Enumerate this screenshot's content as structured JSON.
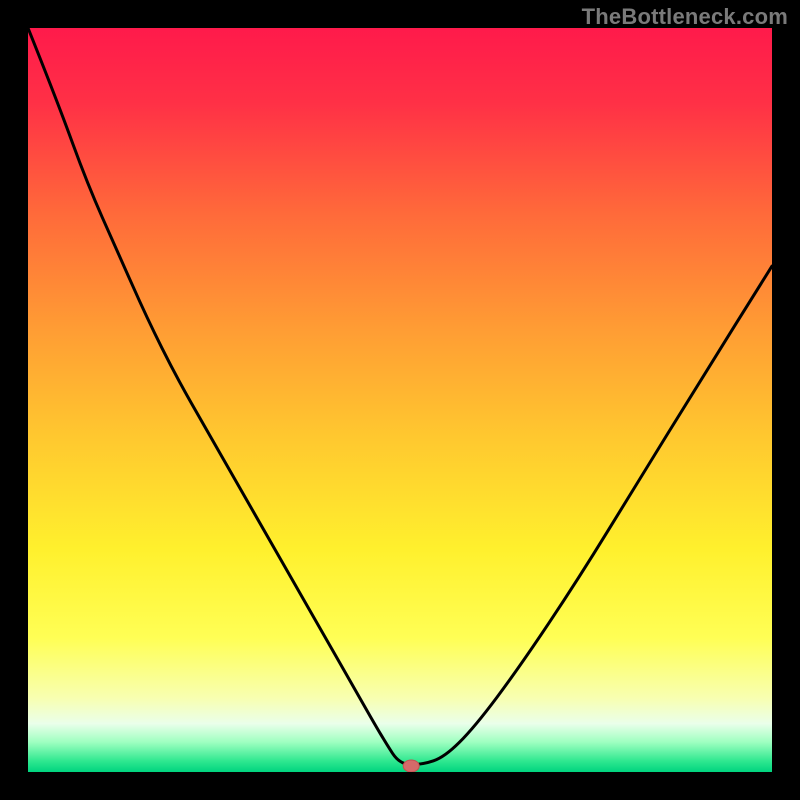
{
  "watermark": "TheBottleneck.com",
  "colors": {
    "gradient_stops": [
      {
        "offset": 0.0,
        "color": "#ff1a4b"
      },
      {
        "offset": 0.1,
        "color": "#ff3046"
      },
      {
        "offset": 0.25,
        "color": "#ff6a3a"
      },
      {
        "offset": 0.4,
        "color": "#ff9b34"
      },
      {
        "offset": 0.55,
        "color": "#ffc82f"
      },
      {
        "offset": 0.7,
        "color": "#fff02d"
      },
      {
        "offset": 0.82,
        "color": "#ffff55"
      },
      {
        "offset": 0.9,
        "color": "#f8ffb0"
      },
      {
        "offset": 0.935,
        "color": "#eaffea"
      },
      {
        "offset": 0.96,
        "color": "#9effc0"
      },
      {
        "offset": 0.985,
        "color": "#30e890"
      },
      {
        "offset": 1.0,
        "color": "#00d47f"
      }
    ],
    "curve": "#000000",
    "marker_fill": "#d46a6a",
    "marker_stroke": "#c54f4f"
  },
  "chart_data": {
    "type": "line",
    "title": "",
    "xlabel": "",
    "ylabel": "",
    "x": [
      0.0,
      0.04,
      0.08,
      0.12,
      0.16,
      0.2,
      0.24,
      0.28,
      0.32,
      0.36,
      0.4,
      0.44,
      0.48,
      0.5,
      0.53,
      0.56,
      0.6,
      0.66,
      0.74,
      0.82,
      0.9,
      1.0
    ],
    "y": [
      1.0,
      0.9,
      0.79,
      0.7,
      0.61,
      0.53,
      0.46,
      0.39,
      0.32,
      0.25,
      0.18,
      0.11,
      0.04,
      0.01,
      0.01,
      0.02,
      0.06,
      0.14,
      0.26,
      0.39,
      0.52,
      0.68
    ],
    "xlim": [
      0,
      1
    ],
    "ylim": [
      0,
      1
    ],
    "marker": {
      "x": 0.515,
      "y": 0.008
    },
    "notes": "Normalized axes (0..1) for both x and y; y measured from bottom of plot area. Curve descends from top-left, reaches ~0 near x≈0.5, then rises to ~0.68 at right edge."
  }
}
